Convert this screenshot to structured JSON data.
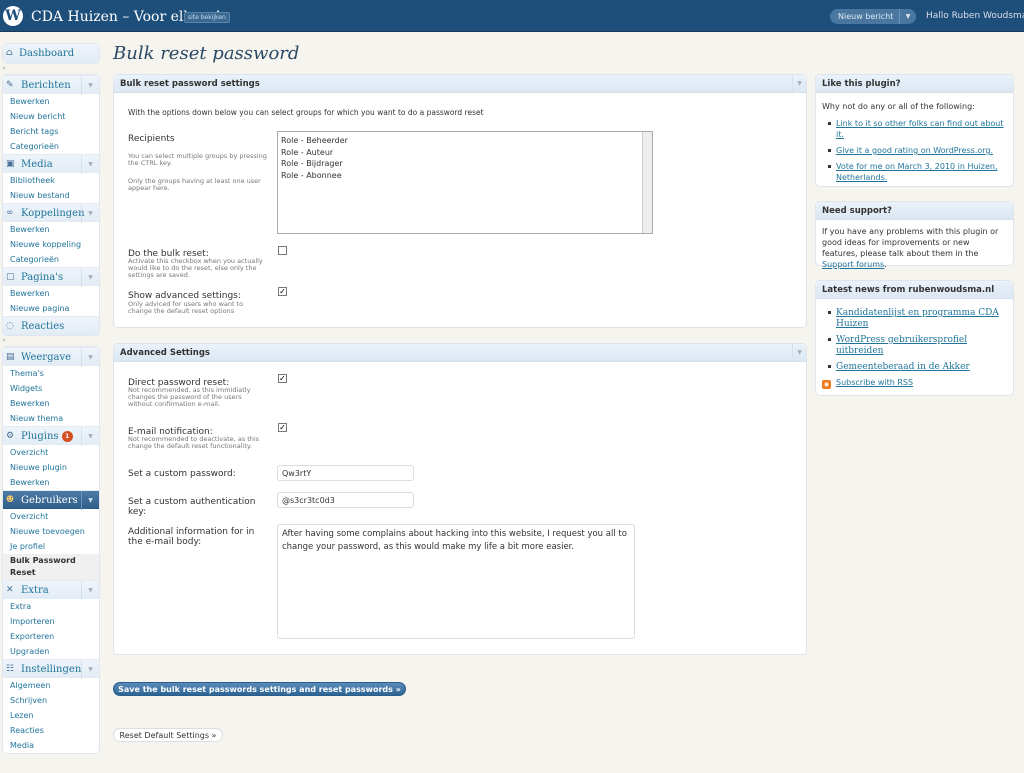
{
  "header": {
    "logo": "W",
    "site_title": "CDA Huizen – Voor elkaar!",
    "visit_site": "site bekijken",
    "new_post": "Nieuw bericht",
    "greeting": "Hallo Ruben Woudsma"
  },
  "sidebar": {
    "groups": [
      {
        "label": "Dashboard",
        "icon": "home-icon",
        "items": []
      },
      {
        "label": "Berichten",
        "icon": "pin-icon",
        "items": [
          "Bewerken",
          "Nieuw bericht",
          "Bericht tags",
          "Categorieën"
        ]
      },
      {
        "label": "Media",
        "icon": "media-icon",
        "items": [
          "Bibliotheek",
          "Nieuw bestand"
        ]
      },
      {
        "label": "Koppelingen",
        "icon": "link-icon",
        "items": [
          "Bewerken",
          "Nieuwe koppeling",
          "Categorieën"
        ]
      },
      {
        "label": "Pagina's",
        "icon": "page-icon",
        "items": [
          "Bewerken",
          "Nieuwe pagina"
        ]
      },
      {
        "label": "Reacties",
        "icon": "comment-icon",
        "items": []
      },
      {
        "label": "Weergave",
        "icon": "appearance-icon",
        "items": [
          "Thema's",
          "Widgets",
          "Bewerken",
          "Nieuw thema"
        ]
      },
      {
        "label": "Plugins",
        "icon": "plugin-icon",
        "badge": "1",
        "items": [
          "Overzicht",
          "Nieuwe plugin",
          "Bewerken"
        ]
      },
      {
        "label": "Gebruikers",
        "icon": "users-icon",
        "active": true,
        "items": [
          "Overzicht",
          "Nieuwe toevoegen",
          "Je profiel",
          "Bulk Password Reset"
        ],
        "current": "Bulk Password Reset"
      },
      {
        "label": "Extra",
        "icon": "tools-icon",
        "items": [
          "Extra",
          "Importeren",
          "Exporteren",
          "Upgraden"
        ]
      },
      {
        "label": "Instellingen",
        "icon": "settings-icon",
        "items": [
          "Algemeen",
          "Schrijven",
          "Lezen",
          "Reacties",
          "Media"
        ]
      }
    ]
  },
  "page_title": "Bulk reset password",
  "settings": {
    "title": "Bulk reset password settings",
    "intro": "With the options down below you can select groups for which you want to do a password reset",
    "recipients_label": "Recipients",
    "recipients_desc1": "You can select multiple groups by pressing the CTRL key.",
    "recipients_desc2": "Only the groups having at least one user appear here.",
    "roles": [
      "Role - Beheerder",
      "Role - Auteur",
      "Role - Bijdrager",
      "Role - Abonnee"
    ],
    "bulk_label": "Do the bulk reset:",
    "bulk_desc": "Activate this checkbox when you actually would like to do the reset, else only the settings are saved.",
    "bulk_checked": false,
    "adv_label": "Show advanced settings:",
    "adv_desc": "Only adviced for users who want to change the default reset options",
    "adv_checked": true
  },
  "advanced": {
    "title": "Advanced Settings",
    "direct_label": "Direct password reset:",
    "direct_desc": "Not recommended, as this immidiatly changes the password of the users without confirmation e-mail.",
    "direct_checked": true,
    "email_label": "E-mail notification:",
    "email_desc": "Not recommended to deactivate, as this change the default reset functionality.",
    "email_checked": true,
    "password_label": "Set a custom password:",
    "password_value": "Qw3rtY",
    "authkey_label": "Set a custom authentication key:",
    "authkey_value": "@s3cr3tc0d3",
    "body_label": "Additional information for in the e-mail body:",
    "body_value": "After having some complains about hacking into this website, I request you all to change your password, as this would make my life a bit more easier."
  },
  "buttons": {
    "save": "Save the bulk reset passwords settings and reset passwords »",
    "reset": "Reset Default Settings »"
  },
  "like": {
    "title": "Like this plugin?",
    "intro": "Why not do any or all of the following:",
    "links": [
      "Link to it so other folks can find out about it.",
      "Give it a good rating on WordPress.org.",
      "Vote for me on March 3, 2010 in Huizen, Netherlands."
    ]
  },
  "support": {
    "title": "Need support?",
    "text": "If you have any problems with this plugin or good ideas for improvements or new features, please talk about them in the",
    "link": "Support forums",
    "end": "."
  },
  "news": {
    "title": "Latest news from rubenwoudsma.nl",
    "items": [
      "Kandidatenlijst en programma CDA Huizen",
      "WordPress gebruikersprofiel uitbreiden",
      "Gemeenteberaad in de Akker"
    ],
    "rss": "Subscribe with RSS"
  }
}
